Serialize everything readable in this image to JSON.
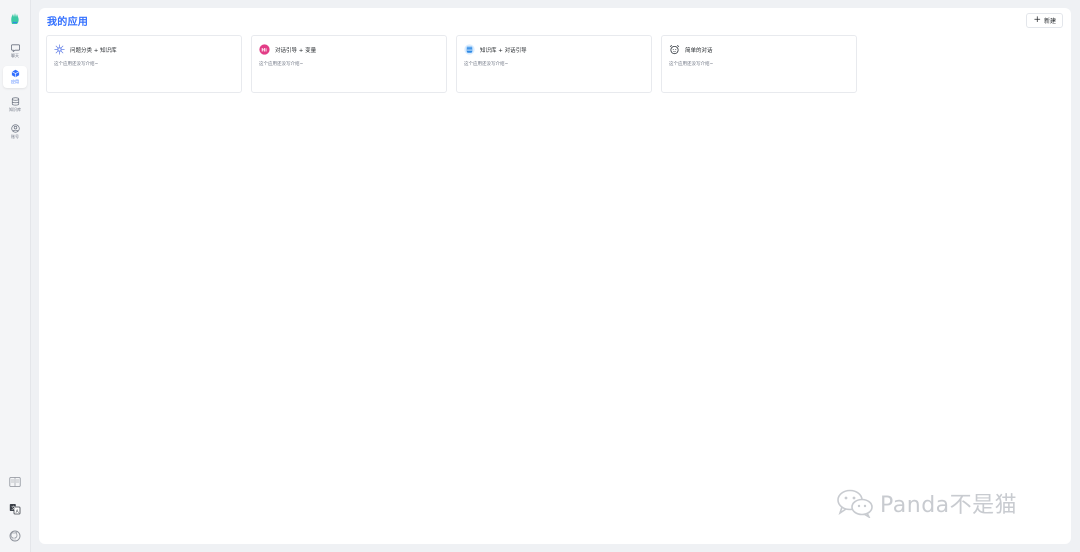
{
  "sidebar": {
    "items": [
      {
        "label": "聊天",
        "icon": "chat-icon",
        "active": false
      },
      {
        "label": "应用",
        "icon": "app-cube-icon",
        "active": true
      },
      {
        "label": "知识库",
        "icon": "database-icon",
        "active": false
      },
      {
        "label": "账号",
        "icon": "account-icon",
        "active": false
      }
    ],
    "bottom_icons": [
      "docs-icon",
      "language-icon",
      "github-icon"
    ]
  },
  "main": {
    "title": "我的应用",
    "new_button_label": "新建"
  },
  "apps": [
    {
      "name": "问题分类 + 知识库",
      "description": "这个应用还没写介绍~",
      "icon": "sparkle-icon"
    },
    {
      "name": "对话引导 + 变量",
      "description": "这个应用还没写介绍~",
      "icon": "hi-badge-icon"
    },
    {
      "name": "知识库 + 对话引导",
      "description": "这个应用还没写介绍~",
      "icon": "knowledge-cup-icon"
    },
    {
      "name": "简单的对话",
      "description": "这个应用还没写介绍~",
      "icon": "alarm-clock-icon"
    }
  ],
  "watermark": {
    "text": "Panda不是猫"
  },
  "colors": {
    "accent": "#3370ff",
    "background": "#eff1f4",
    "hi_badge": "#e23c86",
    "sparkle": "#4f6fe0",
    "cup": "#2e8ae6"
  }
}
